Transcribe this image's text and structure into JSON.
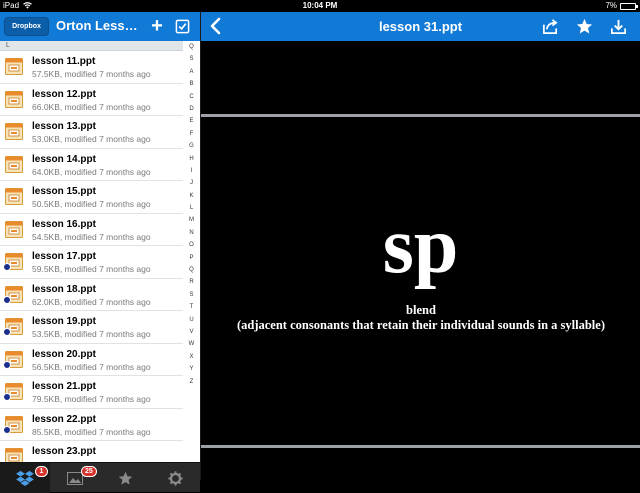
{
  "status": {
    "device": "iPad",
    "time": "10:04 PM",
    "battery": "7%",
    "battery_level": 0.07
  },
  "left": {
    "dropbox_label": "Dropbox",
    "title": "Orton Lessons",
    "section": "L",
    "files": [
      {
        "name": "lesson 11.ppt",
        "meta": "57.5KB, modified 7 months ago",
        "synced": false
      },
      {
        "name": "lesson 12.ppt",
        "meta": "66.0KB, modified 7 months ago",
        "synced": false
      },
      {
        "name": "lesson 13.ppt",
        "meta": "53.0KB, modified 7 months ago",
        "synced": false
      },
      {
        "name": "lesson 14.ppt",
        "meta": "64.0KB, modified 7 months ago",
        "synced": false
      },
      {
        "name": "lesson 15.ppt",
        "meta": "50.5KB, modified 7 months ago",
        "synced": false
      },
      {
        "name": "lesson 16.ppt",
        "meta": "54.5KB, modified 7 months ago",
        "synced": false
      },
      {
        "name": "lesson 17.ppt",
        "meta": "59.5KB, modified 7 months ago",
        "synced": true
      },
      {
        "name": "lesson 18.ppt",
        "meta": "62.0KB, modified 7 months ago",
        "synced": true
      },
      {
        "name": "lesson 19.ppt",
        "meta": "53.5KB, modified 7 months ago",
        "synced": true
      },
      {
        "name": "lesson 20.ppt",
        "meta": "56.5KB, modified 7 months ago",
        "synced": true
      },
      {
        "name": "lesson 21.ppt",
        "meta": "79.5KB, modified 7 months ago",
        "synced": true
      },
      {
        "name": "lesson 22.ppt",
        "meta": "85.5KB, modified 7 months ago",
        "synced": true
      },
      {
        "name": "lesson 23.ppt",
        "meta": "",
        "synced": false
      }
    ],
    "index": [
      "Q",
      "S",
      "A",
      "B",
      "C",
      "D",
      "E",
      "F",
      "G",
      "H",
      "I",
      "J",
      "K",
      "L",
      "M",
      "N",
      "O",
      "P",
      "Q",
      "R",
      "S",
      "T",
      "U",
      "V",
      "W",
      "X",
      "Y",
      "Z"
    ],
    "tabs": [
      {
        "icon": "dropbox-icon",
        "badge": "1"
      },
      {
        "icon": "photos-icon",
        "badge": "25"
      },
      {
        "icon": "star-icon",
        "badge": ""
      },
      {
        "icon": "gear-icon",
        "badge": ""
      }
    ]
  },
  "viewer": {
    "title": "lesson 31.ppt",
    "slide_main": "sp",
    "slide_line1": "blend",
    "slide_line2": "(adjacent consonants that retain their individual sounds in a syllable)"
  },
  "colors": {
    "nav_blue": "#1179d6",
    "badge_red": "#d7342d"
  }
}
